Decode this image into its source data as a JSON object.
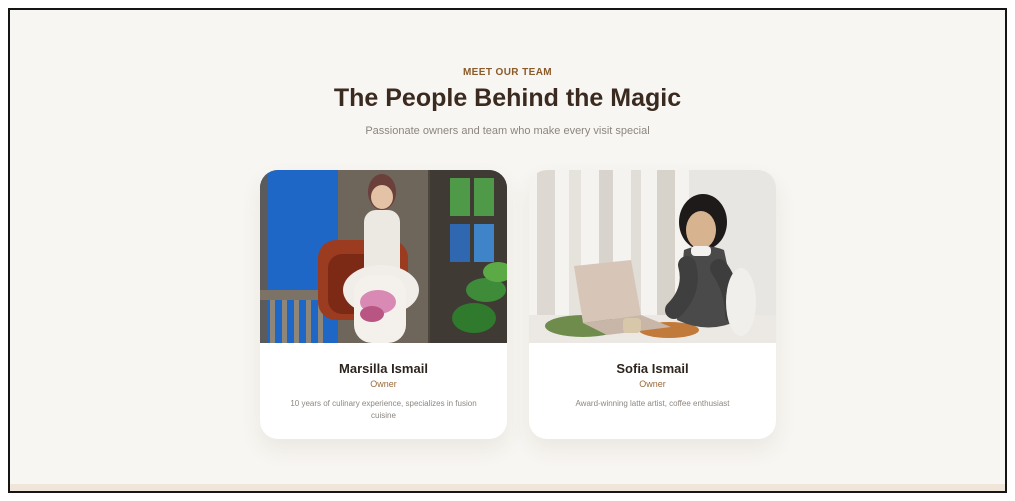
{
  "section": {
    "eyebrow": "MEET OUR TEAM",
    "title": "The People Behind the Magic",
    "subtitle": "Passionate owners and team who make every visit special"
  },
  "team": [
    {
      "name": "Marsilla Ismail",
      "role": "Owner",
      "description": "10 years of culinary experience, specializes in fusion cuisine"
    },
    {
      "name": "Sofia Ismail",
      "role": "Owner",
      "description": "Award-winning latte artist, coffee enthusiast"
    }
  ],
  "colors": {
    "accent": "#8a5a28",
    "heading": "#3b2a20",
    "background": "#f8f6f2",
    "card": "#ffffff",
    "band": "#efe5d9"
  }
}
